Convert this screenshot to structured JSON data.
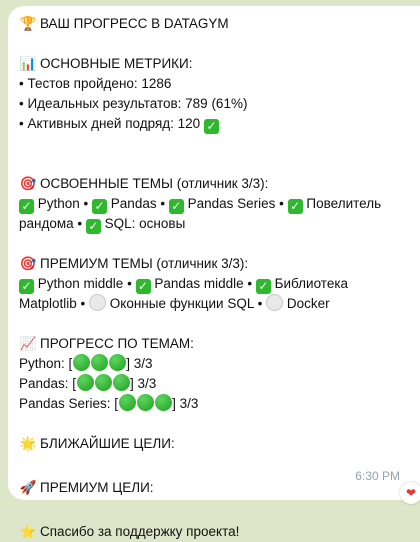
{
  "message": {
    "title": "ВАШ ПРОГРЕСС В DATAGYM",
    "metrics_heading": "ОСНОВНЫЕ МЕТРИКИ:",
    "metrics": [
      "• Тестов пройдено: 1286",
      "• Идеальных результатов: 789 (61%)",
      "• Активных дней подряд: 120"
    ],
    "mastered_heading": "ОСВОЕННЫЕ ТЕМЫ (отличник 3/3):",
    "mastered": [
      {
        "label": "Python",
        "sep": " • "
      },
      {
        "label": "Pandas",
        "sep": " • "
      },
      {
        "label": "Pandas Series",
        "sep": " • "
      },
      {
        "label": "Повелитель рандома",
        "sep": " • "
      },
      {
        "label": "SQL: основы",
        "sep": ""
      }
    ],
    "premium_heading": "ПРЕМИУМ ТЕМЫ (отличник 3/3):",
    "premium": [
      {
        "label": "Python middle",
        "done": true,
        "sep": " • "
      },
      {
        "label": "Pandas middle",
        "done": true,
        "sep": " • "
      },
      {
        "label": "Библиотека Matplotlib",
        "done": true,
        "sep": " • "
      },
      {
        "label": "Оконные функции SQL",
        "done": false,
        "sep": " • "
      },
      {
        "label": "Docker",
        "done": false,
        "sep": ""
      }
    ],
    "progress_heading": "ПРОГРЕСС ПО ТЕМАМ:",
    "progress": [
      {
        "label": "Python: [",
        "filled": 3,
        "score": "] 3/3"
      },
      {
        "label": "Pandas: [",
        "filled": 3,
        "score": "] 3/3"
      },
      {
        "label": "Pandas Series: [",
        "filled": 3,
        "score": "] 3/3"
      }
    ],
    "goals_heading": "БЛИЖАЙШИЕ ЦЕЛИ:",
    "premium_goals_heading": "ПРЕМИУМ ЦЕЛИ:",
    "thanks": "Спасибо за поддержку проекта!",
    "time": "6:30 PM"
  },
  "icons": {
    "title": "trophy-icon",
    "metrics": "bar-chart-icon",
    "check": "check-mark-icon",
    "mastered": "target-icon",
    "premium": "target-icon",
    "progress": "chart-increasing-icon",
    "goals": "glowing-star-icon",
    "premium_goals": "rocket-icon",
    "thanks": "star-icon",
    "reaction": "heart-icon"
  },
  "colors": {
    "background": "#dde6c8",
    "bubble": "#ffffff",
    "check_green": "#2eb82e",
    "time": "#93a4ae"
  }
}
